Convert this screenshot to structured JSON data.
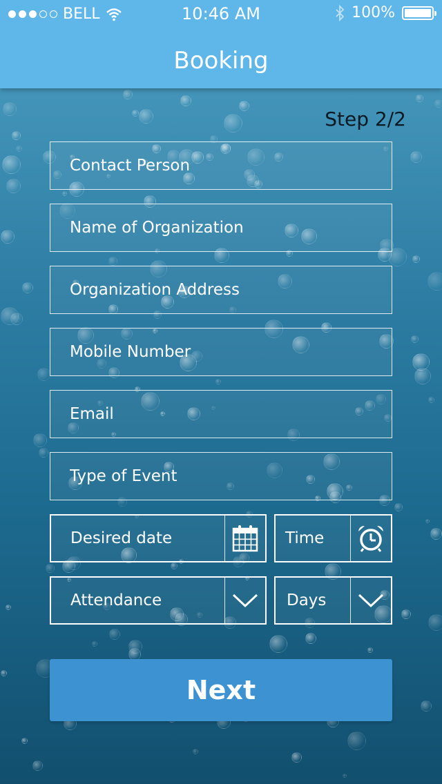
{
  "status_bar": {
    "carrier": "BELL",
    "time": "10:46 AM",
    "battery": "100%",
    "signal_icon": "signal-dots-icon",
    "wifi_icon": "wifi-icon",
    "bluetooth_icon": "bluetooth-icon",
    "battery_icon": "battery-icon"
  },
  "header": {
    "title": "Booking",
    "menu_icon": "hamburger-menu-icon",
    "background": "#5fb6e8"
  },
  "step_indicator": "Step 2/2",
  "form": {
    "contact_person": "Contact Person",
    "organization_name": "Name of Organization",
    "organization_address": "Organization Address",
    "mobile_number": "Mobile Number",
    "email": "Email",
    "event_type": "Type of Event",
    "desired_date": "Desired date",
    "time": "Time",
    "attendance": "Attendance",
    "days": "Days"
  },
  "icons": {
    "date": "calendar-icon",
    "time": "alarm-clock-icon",
    "dropdown": "chevron-down-icon"
  },
  "next_button": {
    "label": "Next",
    "color": "#3d92d2"
  }
}
